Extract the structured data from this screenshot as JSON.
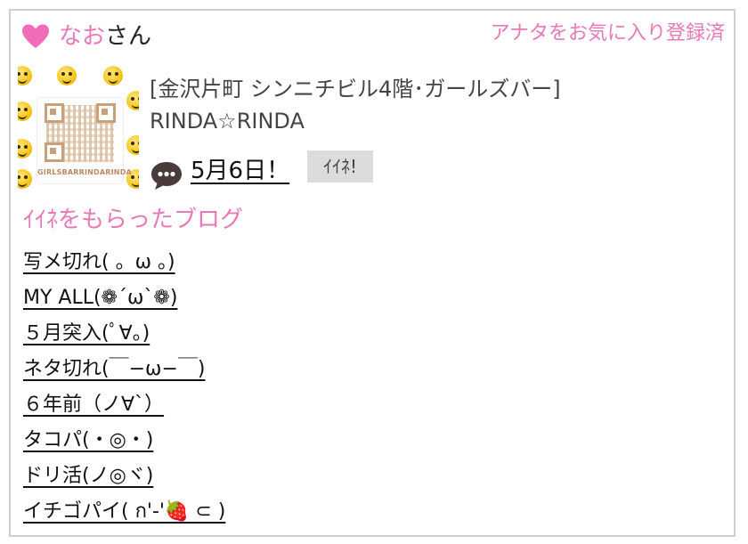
{
  "user": {
    "name": "なお",
    "suffix": "さん"
  },
  "favorite_link": "アナタをお気に入り登録済",
  "avatar": {
    "qr_caption": "GIRLSBARRINDARINDA"
  },
  "shop": {
    "line1": "[金沢片町 シンニチビル4階･ガールズバー]",
    "line2": "RINDA☆RINDA"
  },
  "post": {
    "date_link": "5月6日！",
    "iine_button": "ｲｲﾈ!"
  },
  "liked_blogs": {
    "title": "ｲｲﾈをもらったブログ",
    "items": [
      "写メ切れ( 。ω 。)",
      "MY ALL(❁´ω`❁)",
      "５月突入(ﾟ∀。)",
      "ネタ切れ(￣−ω−￣)",
      "６年前（ノ∀`）",
      "タコパ(・◎・)",
      "ドリ活(ノ◎ヾ)",
      "イチゴパイ( ก'-'🍓 ⊂ )"
    ]
  },
  "colors": {
    "accent_pink": "#e879b8",
    "button_gray": "#dcdcdc",
    "border": "#cfcfcf"
  },
  "icons": [
    "heart-icon",
    "comment-icon"
  ]
}
